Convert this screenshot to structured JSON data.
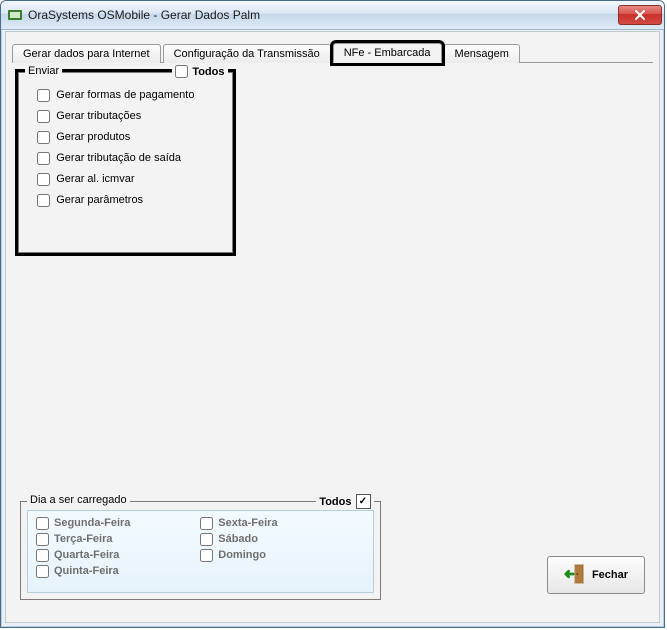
{
  "window": {
    "title": "OraSystems OSMobile - Gerar Dados Palm"
  },
  "tabs": {
    "t0": "Gerar dados para Internet",
    "t1": "Configuração da Transmissão",
    "t2": "NFe - Embarcada",
    "t3": "Mensagem",
    "active_index": 2
  },
  "enviar": {
    "legend": "Enviar",
    "todos_label": "Todos",
    "todos_checked": false,
    "items": [
      {
        "label": "Gerar formas de pagamento",
        "checked": false
      },
      {
        "label": "Gerar tributações",
        "checked": false
      },
      {
        "label": "Gerar produtos",
        "checked": false
      },
      {
        "label": "Gerar tributação de saída",
        "checked": false
      },
      {
        "label": "Gerar al. icmvar",
        "checked": false
      },
      {
        "label": "Gerar parâmetros",
        "checked": false
      }
    ]
  },
  "dia": {
    "legend": "Dia a ser carregado",
    "todos_label": "Todos",
    "todos_checked": true,
    "col1": [
      {
        "label": "Segunda-Feira",
        "checked": false
      },
      {
        "label": "Terça-Feira",
        "checked": false
      },
      {
        "label": "Quarta-Feira",
        "checked": false
      },
      {
        "label": "Quinta-Feira",
        "checked": false
      }
    ],
    "col2": [
      {
        "label": "Sexta-Feira",
        "checked": false
      },
      {
        "label": "Sábado",
        "checked": false
      },
      {
        "label": "Domingo",
        "checked": false
      }
    ]
  },
  "buttons": {
    "fechar": "Fechar"
  }
}
